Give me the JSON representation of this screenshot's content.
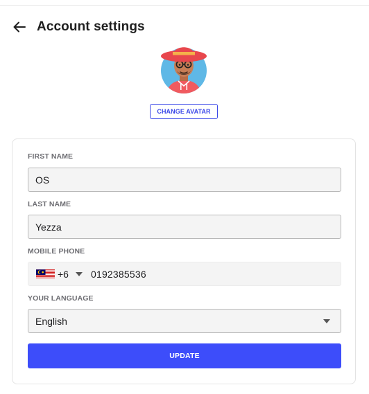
{
  "header": {
    "title": "Account settings",
    "back_icon": "arrow-left-icon"
  },
  "avatar": {
    "icon": "avatar-illustration-red-hat-glasses",
    "change_label": "CHANGE AVATAR"
  },
  "form": {
    "first_name": {
      "label": "FIRST NAME",
      "value": "OS"
    },
    "last_name": {
      "label": "LAST NAME",
      "value": "Yezza"
    },
    "mobile_phone": {
      "label": "MOBILE PHONE",
      "country_flag": "malaysia-flag-icon",
      "dial_code": "+6",
      "number": "0192385536"
    },
    "language": {
      "label": "YOUR LANGUAGE",
      "selected": "English"
    },
    "submit_label": "UPDATE"
  },
  "colors": {
    "accent": "#3d4dfa",
    "outline_accent": "#3b48e8",
    "input_bg": "#f4f4f4"
  }
}
